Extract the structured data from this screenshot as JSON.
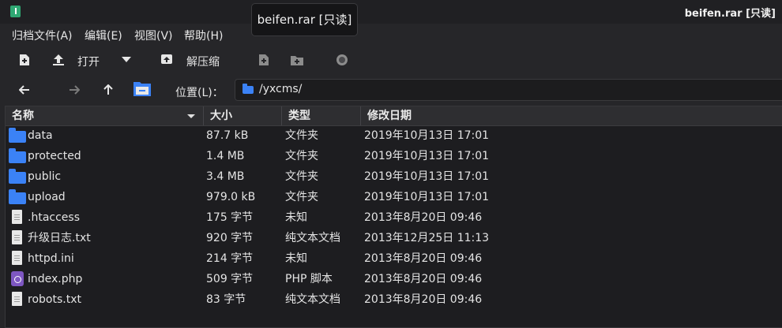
{
  "window": {
    "title": "beifen.rar [只读]",
    "tooltip": "beifen.rar [只读]"
  },
  "menu": [
    "归档文件(A)",
    "编辑(E)",
    "视图(V)",
    "帮助(H)"
  ],
  "toolbar": {
    "open_label": "打开",
    "extract_label": "解压缩"
  },
  "location": {
    "label": "位置(L)：",
    "path": "/yxcms/"
  },
  "columns": [
    "名称",
    "大小",
    "类型",
    "修改日期"
  ],
  "files": [
    {
      "name": "data",
      "size": "87.7 kB",
      "type": "文件夹",
      "modified": "2019年10月13日 17:01",
      "icon": "folder-icon"
    },
    {
      "name": "protected",
      "size": "1.4 MB",
      "type": "文件夹",
      "modified": "2019年10月13日 17:01",
      "icon": "folder-icon"
    },
    {
      "name": "public",
      "size": "3.4 MB",
      "type": "文件夹",
      "modified": "2019年10月13日 17:01",
      "icon": "folder-icon"
    },
    {
      "name": "upload",
      "size": "979.0 kB",
      "type": "文件夹",
      "modified": "2019年10月13日 17:01",
      "icon": "folder-icon"
    },
    {
      "name": ".htaccess",
      "size": "175 字节",
      "type": "未知",
      "modified": "2013年8月20日 09:46",
      "icon": "document-icon"
    },
    {
      "name": "升级日志.txt",
      "size": "920 字节",
      "type": "纯文本文档",
      "modified": "2013年12月25日 11:13",
      "icon": "text-document-icon"
    },
    {
      "name": "httpd.ini",
      "size": "214 字节",
      "type": "未知",
      "modified": "2013年8月20日 09:46",
      "icon": "document-icon"
    },
    {
      "name": "index.php",
      "size": "509 字节",
      "type": "PHP 脚本",
      "modified": "2013年8月20日 09:46",
      "icon": "php-icon"
    },
    {
      "name": "robots.txt",
      "size": "83 字节",
      "type": "纯文本文档",
      "modified": "2013年8月20日 09:46",
      "icon": "text-document-icon"
    }
  ],
  "colors": {
    "background": "#262629",
    "list_background": "#1d1d20",
    "folder": "#3b82f6",
    "php": "#7e57c2",
    "app_icon": "#2fa873"
  }
}
